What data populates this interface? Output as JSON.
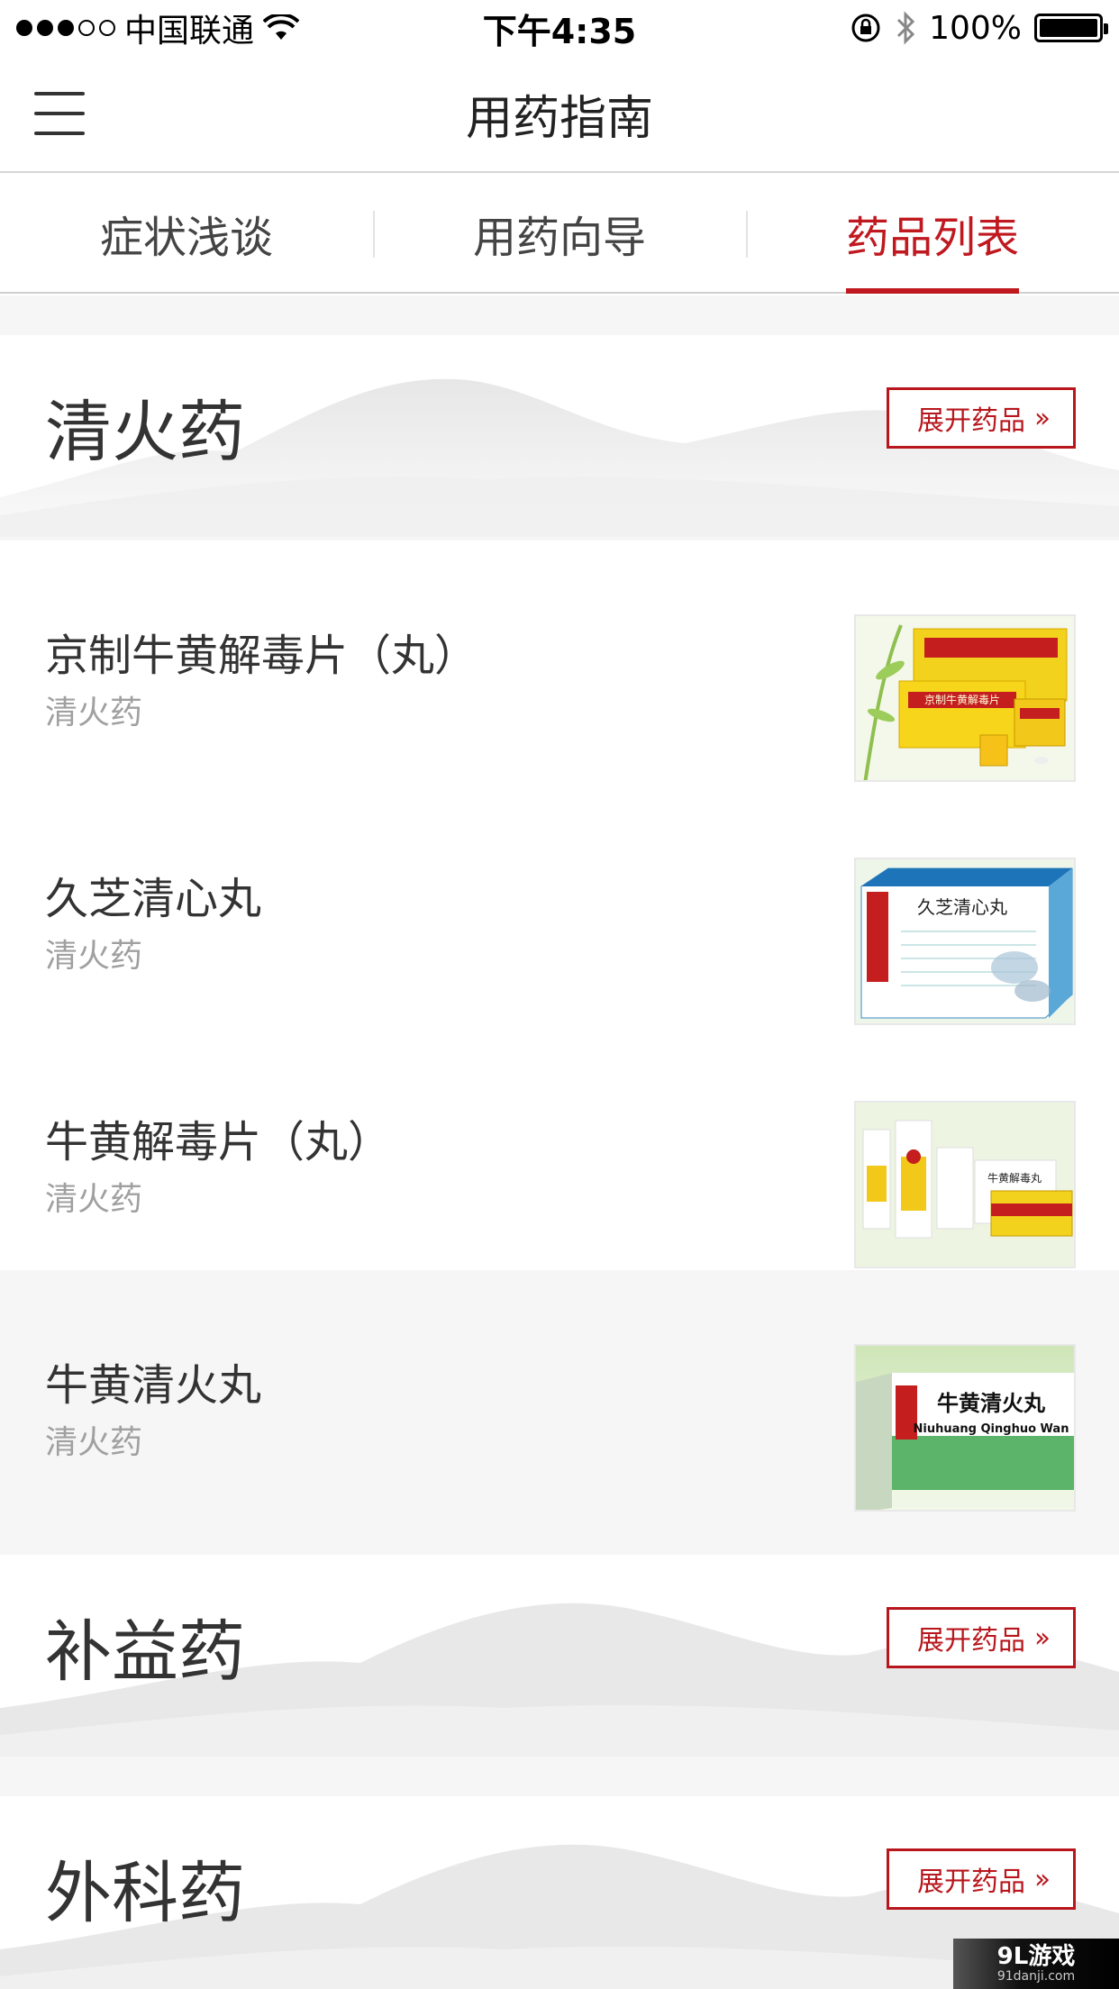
{
  "status_bar": {
    "carrier": "中国联通",
    "time": "下午4:35",
    "battery": "100%",
    "battery_level": 1.0,
    "signal_bars": 3
  },
  "nav": {
    "title": "用药指南",
    "menu_icon": "hamburger-menu-icon"
  },
  "tabs": [
    {
      "label": "症状浅谈",
      "active": false
    },
    {
      "label": "用药向导",
      "active": false
    },
    {
      "label": "药品列表",
      "active": true
    }
  ],
  "expand_label": "展开药品",
  "categories": [
    {
      "title": "清火药",
      "drugs": [
        {
          "name": "京制牛黄解毒片（丸）",
          "category": "清火药",
          "image_label": "京制牛黄解毒片"
        },
        {
          "name": "久芝清心丸",
          "category": "清火药",
          "image_label": "久芝清心丸"
        },
        {
          "name": "牛黄解毒片（丸）",
          "category": "清火药",
          "image_label": "牛黄解毒丸"
        },
        {
          "name": "牛黄清火丸",
          "category": "清火药",
          "image_label": "牛黄清火丸",
          "image_label_en": "Niuhuang Qinghuo Wan"
        }
      ]
    },
    {
      "title": "补益药",
      "drugs": []
    },
    {
      "title": "外科药",
      "drugs": []
    }
  ],
  "watermark": {
    "main": "9L游戏",
    "sub": "91danji.com"
  },
  "colors": {
    "accent": "#c0181f",
    "text": "#333333",
    "muted": "#a0a0a0"
  }
}
